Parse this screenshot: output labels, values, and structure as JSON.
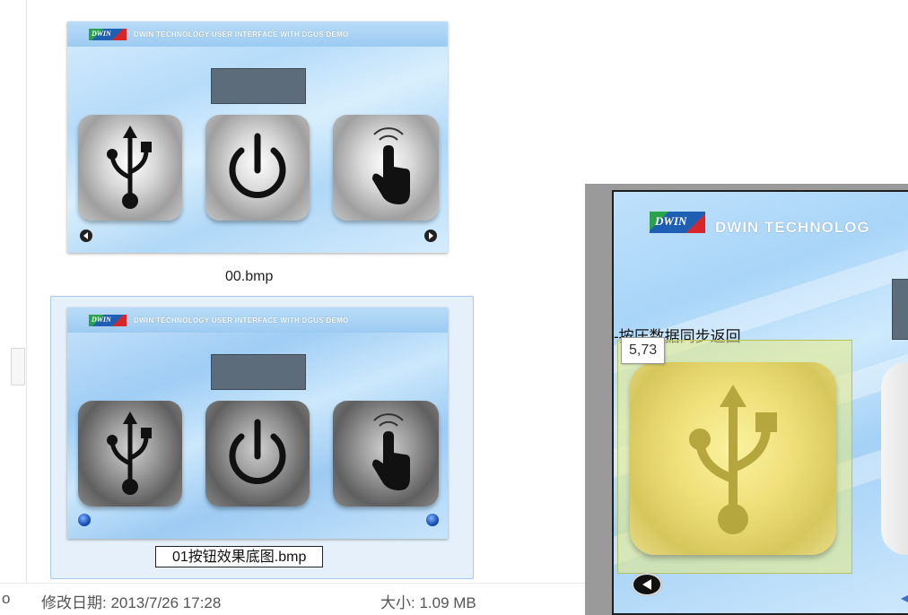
{
  "files": [
    {
      "name": "00.bmp",
      "thumb_title": "DWIN TECHNOLOGY USER INTERFACE WITH DGUS DEMO",
      "logo_text": "DWIN",
      "selected": false
    },
    {
      "name": "01按钮效果底图.bmp",
      "thumb_title": "DWIN TECHNOLOGY USER INTERFACE WITH DGUS DEMO",
      "logo_text": "DWIN",
      "selected": true
    }
  ],
  "status_bar": {
    "left_fragment": "o",
    "modified_label": "修改日期: 2013/7/26 17:28",
    "size_label": "大小: 1.09 MB"
  },
  "editor": {
    "logo_text": "DWIN",
    "title": "DWIN TECHNOLOG",
    "touch_label": "-按压数据同步返回",
    "tooltip": "5,73",
    "highlight_color": "#e6eb82"
  }
}
